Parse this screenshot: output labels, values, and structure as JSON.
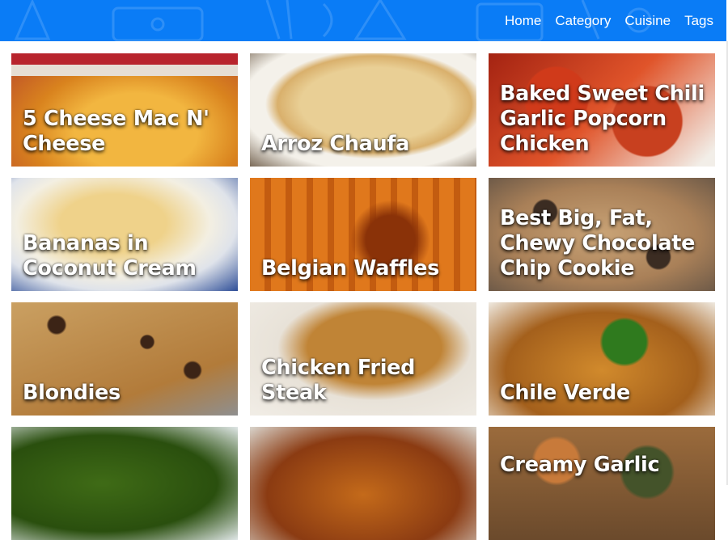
{
  "nav": {
    "items": [
      "Home",
      "Category",
      "Cuisine",
      "Tags"
    ]
  },
  "colors": {
    "header": "#0a7cf6",
    "card_title": "#ffffff"
  },
  "recipes": [
    {
      "title": "5 Cheese Mac N' Cheese"
    },
    {
      "title": "Arroz Chaufa"
    },
    {
      "title": "Baked Sweet Chili Garlic Popcorn Chicken"
    },
    {
      "title": "Bananas in Coconut Cream"
    },
    {
      "title": "Belgian Waffles"
    },
    {
      "title": "Best Big, Fat, Chewy Chocolate Chip Cookie"
    },
    {
      "title": "Blondies"
    },
    {
      "title": "Chicken Fried Steak"
    },
    {
      "title": "Chile Verde"
    },
    {
      "title": ""
    },
    {
      "title": ""
    },
    {
      "title": "Creamy Garlic"
    }
  ]
}
